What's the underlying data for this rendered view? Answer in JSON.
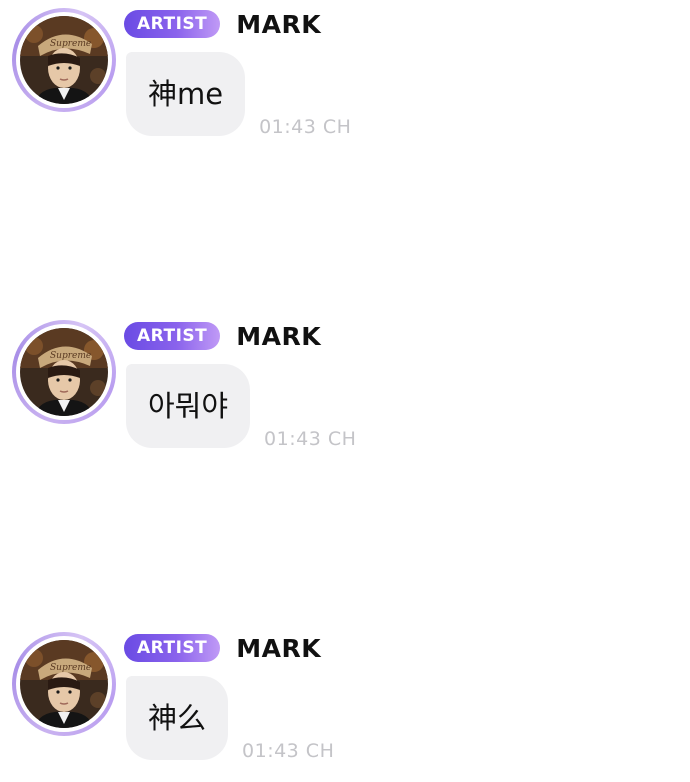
{
  "messages": [
    {
      "badge": "ARTIST",
      "sender": "MARK",
      "text": "神me",
      "time": "01:43 CH"
    },
    {
      "badge": "ARTIST",
      "sender": "MARK",
      "text": "아뭐야",
      "time": "01:43 CH"
    },
    {
      "badge": "ARTIST",
      "sender": "MARK",
      "text": "神么",
      "time": "01:43 CH"
    }
  ],
  "colors": {
    "badge_gradient_start": "#6a4be4",
    "badge_gradient_end": "#c09af6",
    "bubble_bg": "#f0f0f2",
    "timestamp": "#c4c4c8",
    "name": "#111111"
  },
  "icons": {
    "avatar": "avatar-photo"
  }
}
